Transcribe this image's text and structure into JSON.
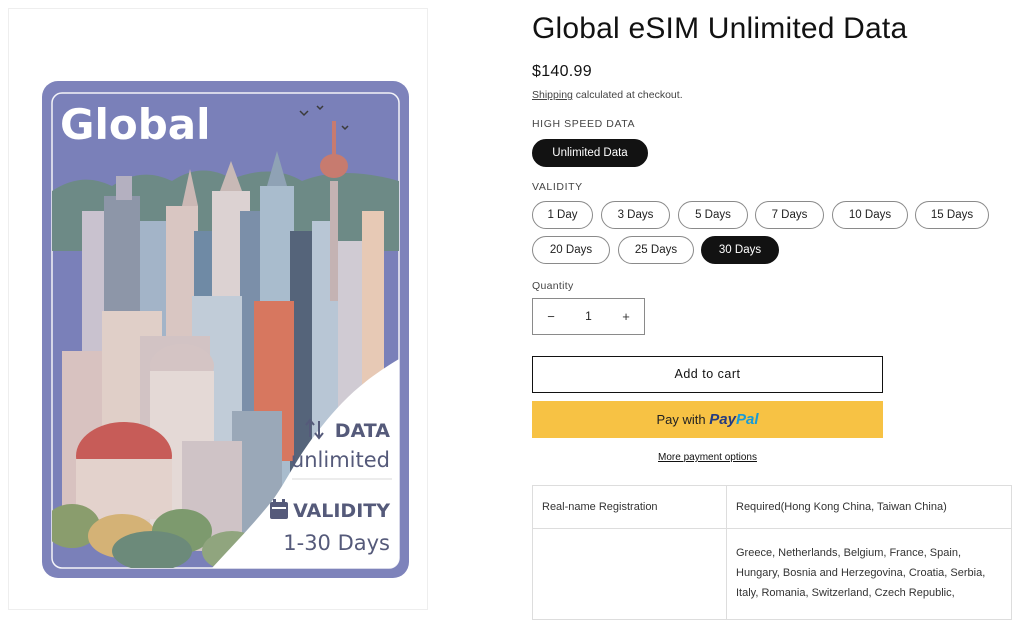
{
  "product": {
    "title": "Global eSIM Unlimited Data",
    "price": "$140.99",
    "shipping_link": "Shipping",
    "shipping_note": " calculated at checkout."
  },
  "card": {
    "headline": "Global",
    "data_label": "DATA",
    "data_value": "unlimited",
    "validity_label": "VALIDITY",
    "validity_value": "1-30 Days",
    "colors": {
      "frame": "#7e83bb",
      "sky": "#7a80b9",
      "inner_border": "#f3f3f8"
    }
  },
  "options": {
    "high_speed_label": "HIGH SPEED DATA",
    "high_speed": [
      {
        "label": "Unlimited Data",
        "selected": true
      }
    ],
    "validity_label": "VALIDITY",
    "validity": [
      {
        "label": "1 Day",
        "selected": false
      },
      {
        "label": "3 Days",
        "selected": false
      },
      {
        "label": "5 Days",
        "selected": false
      },
      {
        "label": "7 Days",
        "selected": false
      },
      {
        "label": "10 Days",
        "selected": false
      },
      {
        "label": "15 Days",
        "selected": false
      },
      {
        "label": "20 Days",
        "selected": false
      },
      {
        "label": "25 Days",
        "selected": false
      },
      {
        "label": "30 Days",
        "selected": true
      }
    ]
  },
  "quantity": {
    "label": "Quantity",
    "value": "1",
    "minus": "−",
    "plus": "+"
  },
  "actions": {
    "add_to_cart": "Add to cart",
    "paypal_prefix": "Pay with",
    "paypal_brand_1": "Pay",
    "paypal_brand_2": "Pal",
    "more_payment": "More payment options"
  },
  "specs": {
    "rows": [
      {
        "key": "Real-name Registration",
        "value": "Required(Hong Kong China, Taiwan China)"
      },
      {
        "key": "",
        "value": "Greece, Netherlands, Belgium, France, Spain, Hungary, Bosnia and Herzegovina, Croatia, Serbia, Italy, Romania, Switzerland, Czech Republic,"
      }
    ]
  },
  "colors": {
    "accent_dark": "#121212",
    "paypal_yellow": "#f7c244",
    "paypal_navy": "#253b80",
    "paypal_blue": "#179bd7"
  }
}
